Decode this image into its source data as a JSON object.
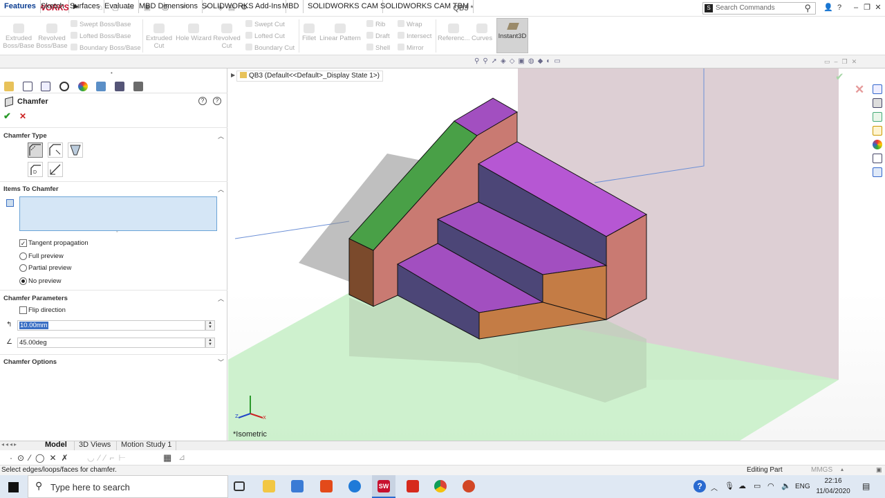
{
  "app": {
    "brand": "SOLIDWORKS",
    "doc_title": "QB3 *"
  },
  "search": {
    "placeholder": "Search Commands"
  },
  "ribbon": {
    "extruded_boss": "Extruded Boss/Base",
    "revolved_boss": "Revolved Boss/Base",
    "swept_boss": "Swept Boss/Base",
    "lofted_boss": "Lofted Boss/Base",
    "boundary_boss": "Boundary Boss/Base",
    "extruded_cut": "Extruded Cut",
    "hole_wizard": "Hole Wizard",
    "revolved_cut": "Revolved Cut",
    "swept_cut": "Swept Cut",
    "lofted_cut": "Lofted Cut",
    "boundary_cut": "Boundary Cut",
    "fillet": "Fillet",
    "linear_pattern": "Linear Pattern",
    "rib": "Rib",
    "draft": "Draft",
    "shell": "Shell",
    "wrap": "Wrap",
    "intersect": "Intersect",
    "mirror": "Mirror",
    "reference": "Referenc...",
    "curves": "Curves",
    "instant3d": "Instant3D"
  },
  "tabs": [
    "Features",
    "Sketch",
    "Surfaces",
    "Evaluate",
    "MBD Dimensions",
    "SOLIDWORKS Add-Ins",
    "MBD",
    "SOLIDWORKS CAM",
    "SOLIDWORKS CAM TBM"
  ],
  "property_manager": {
    "title": "Chamfer",
    "chamfer_type_label": "Chamfer Type",
    "items_label": "Items To Chamfer",
    "tangent_propagation": "Tangent propagation",
    "full_preview": "Full preview",
    "partial_preview": "Partial preview",
    "no_preview": "No preview",
    "params_label": "Chamfer Parameters",
    "flip_direction": "Flip direction",
    "distance_value": "10.00mm",
    "angle_value": "45.00deg",
    "options_label": "Chamfer Options"
  },
  "viewport": {
    "breadcrumb": "QB3  (Default<<Default>_Display State 1>)",
    "view_label": "*Isometric",
    "colors": {
      "top_face": "#a24fc0",
      "side_face": "#c97a72",
      "riser": "#4c4677",
      "front_low": "#c47c45",
      "slope": "#49a047",
      "floor": "#c9efc9"
    }
  },
  "bottom_tabs": [
    "Model",
    "3D Views",
    "Motion Study 1"
  ],
  "status": {
    "message": "Select edges/loops/faces for chamfer.",
    "editing": "Editing Part",
    "units": "MMGS"
  },
  "taskbar": {
    "search_placeholder": "Type here to search",
    "lang": "ENG",
    "time": "22:16",
    "date": "11/04/2020"
  }
}
